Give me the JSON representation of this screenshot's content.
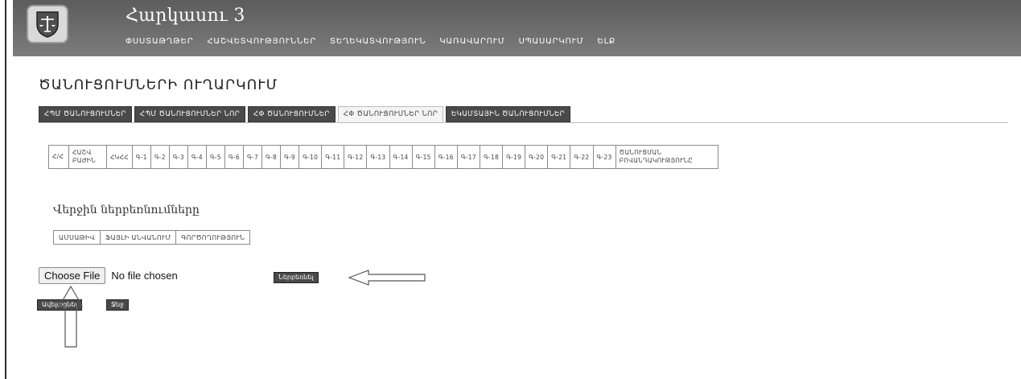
{
  "header": {
    "app_title": "Հարկասու 3",
    "nav": [
      "ՓՍՍՏԱԹՂԹԵՐ",
      "ՀԱՇՎԵՏՎՈՒԹՅՈՒՆՆԵՐ",
      "ՏԵՂԵԿԱՏՎՈՒԹՅՈՒՆ",
      "ԿԱՌԱՎԱՐՈՒՄ",
      "ՍՊԱՍԱՐԿՈՒՄ",
      "ԵԼՔ"
    ],
    "logo_icon": "shield-scales-emblem"
  },
  "page": {
    "title": "ԾԱՆՈՒՑՈՒՄՆԵՐԻ ՈՒՂԱՐԿՈՒՄ"
  },
  "tabs": [
    {
      "label": "ՀՊՄ ԾԱՆՈՒՑՈՒՄՆԵՐ",
      "active": false
    },
    {
      "label": "ՀՊՄ ԾԱՆՈՒՑՈՒՄՆԵՐ ՆՈՐ",
      "active": false
    },
    {
      "label": "ՀՓ ԾԱՆՈՒՑՈՒՄՆԵՐ",
      "active": false
    },
    {
      "label": "ՀՓ ԾԱՆՈՒՑՈՒՄՆԵՐ ՆՈՐ",
      "active": true
    },
    {
      "label": "ԵԿԱՄՏԱՅԻՆ ԾԱՆՈՒՑՈՒՄՆԵՐ",
      "active": false
    }
  ],
  "day_table": {
    "cells": [
      "Հ/Հ",
      "ՀԱՇՎ ԲԱԺԻՆ",
      "ՀԿՀՀ",
      "Գ-1",
      "Գ-2",
      "Գ-3",
      "Գ-4",
      "Գ-5",
      "Գ-6",
      "Գ-7",
      "Գ-8",
      "Գ-9",
      "Գ-10",
      "Գ-11",
      "Գ-12",
      "Գ-13",
      "Գ-14",
      "Գ-15",
      "Գ-16",
      "Գ-17",
      "Գ-18",
      "Գ-19",
      "Գ-20",
      "Գ-21",
      "Գ-22",
      "Գ-23",
      "ԾԱՆՈՒՑՄԱՆ ԲՈՎԱՆԴԱԿՈՒԹՅՈՒՆԸ"
    ]
  },
  "recent": {
    "title": "Վերջին ներբեռնումները",
    "columns": [
      "ԱՄՍԱԹԻՎ",
      "ՖԱՅԼԻ ԱՆՎԱՆՈՒՄ",
      "ԳՈՐԾՈՂՈՒԹՅՈՒՆ"
    ]
  },
  "upload": {
    "choose_label": "Choose File",
    "status": "No file chosen",
    "upload_button": "Ներբեռնել",
    "add_button": "Ավելացնել",
    "delete_button": "Ջնջ"
  },
  "colors": {
    "header_bg": "#6a6a6a",
    "tab_dark": "#4a4a4a",
    "tab_active": "#f4f4f4"
  }
}
